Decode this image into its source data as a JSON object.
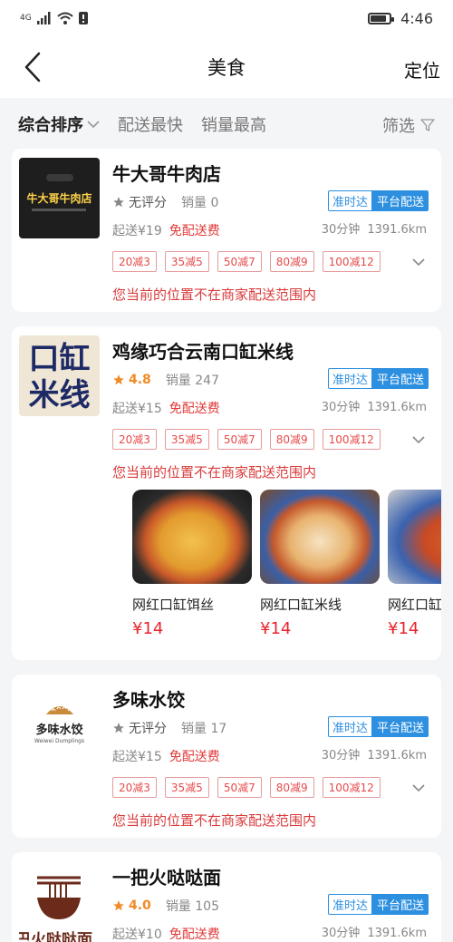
{
  "status": {
    "network": "4G",
    "time": "4:46"
  },
  "nav": {
    "title": "美食",
    "right": "定位"
  },
  "filters": {
    "items": [
      "综合排序",
      "配送最快",
      "销量最高"
    ],
    "right": "筛选"
  },
  "shops": [
    {
      "name": "牛大哥牛肉店",
      "logo_text": "牛大哥牛肉店",
      "rating": "无评分",
      "sales": "销量 0",
      "tag_ontime": "准时达",
      "tag_platform": "平台配送",
      "min_order": "起送¥19",
      "free_delivery": "免配送费",
      "time": "30分钟",
      "distance": "1391.6km",
      "promos": [
        "20减3",
        "35减5",
        "50减7",
        "80减9",
        "100减12"
      ],
      "warning": "您当前的位置不在商家配送范围内"
    },
    {
      "name": "鸡缘巧合云南口缸米线",
      "logo_text": [
        "口缸",
        "米线"
      ],
      "rating": "4.8",
      "sales": "销量 247",
      "tag_ontime": "准时达",
      "tag_platform": "平台配送",
      "min_order": "起送¥15",
      "free_delivery": "免配送费",
      "time": "30分钟",
      "distance": "1391.6km",
      "promos": [
        "20减3",
        "35减5",
        "50减7",
        "80减9",
        "100减12"
      ],
      "warning": "您当前的位置不在商家配送范围内",
      "dishes": [
        {
          "name": "网红口缸饵丝",
          "price": "¥14"
        },
        {
          "name": "网红口缸米线",
          "price": "¥14"
        },
        {
          "name": "网红口缸",
          "price": "¥14"
        }
      ]
    },
    {
      "name": "多味水饺",
      "logo_text": "多味水饺",
      "logo_sub": "Weiwei Dumplings",
      "rating": "无评分",
      "sales": "销量 17",
      "tag_ontime": "准时达",
      "tag_platform": "平台配送",
      "min_order": "起送¥15",
      "free_delivery": "免配送费",
      "time": "30分钟",
      "distance": "1391.6km",
      "promos": [
        "20减3",
        "35减5",
        "50减7",
        "80减9",
        "100减12"
      ],
      "warning": "您当前的位置不在商家配送范围内"
    },
    {
      "name": "一把火哒哒面",
      "logo_text": "巴火哒哒面",
      "rating": "4.0",
      "sales": "销量 105",
      "tag_ontime": "准时达",
      "tag_platform": "平台配送",
      "min_order": "起送¥10",
      "free_delivery": "免配送费",
      "time": "30分钟",
      "distance": "1391.6km"
    }
  ],
  "colors": {
    "accent_blue": "#2c8fe0",
    "warn_red": "#d93b3b",
    "price_red": "#e8242c",
    "rating_orange": "#f08a24"
  }
}
